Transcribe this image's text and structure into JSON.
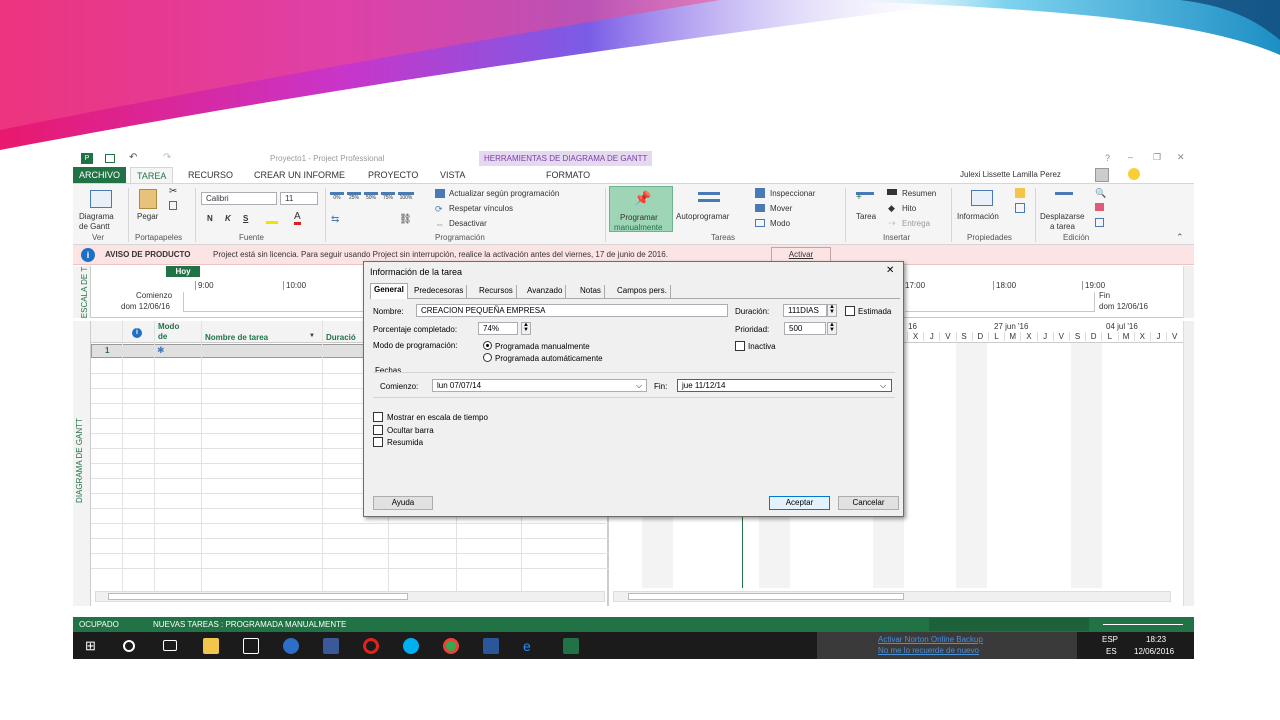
{
  "window": {
    "title": "Proyecto1 - Project Professional",
    "contextual_tab": "HERRAMIENTAS DE DIAGRAMA DE GANTT",
    "user": "Julexi Lissette Lamilla Perez"
  },
  "tabs": [
    "ARCHIVO",
    "TAREA",
    "RECURSO",
    "CREAR UN INFORME",
    "PROYECTO",
    "VISTA",
    "FORMATO"
  ],
  "ribbon": {
    "ver": {
      "btn": "Diagrama",
      "btn2": "de Gantt",
      "group": "Ver"
    },
    "portapapeles": {
      "btn": "Pegar",
      "group": "Portapapeles"
    },
    "fuente": {
      "font": "Calibri",
      "size": "11",
      "bold": "N",
      "italic": "K",
      "underline": "S",
      "group": "Fuente"
    },
    "programacion": {
      "pcts": [
        "0%",
        "25%",
        "50%",
        "75%",
        "100%"
      ],
      "update": "Actualizar según programación",
      "respect": "Respetar vínculos",
      "deactivate": "Desactivar",
      "group": "Programación"
    },
    "tareas": {
      "manual": "Programar",
      "manual2": "manualmente",
      "auto": "Autoprogramar",
      "inspect": "Inspeccionar",
      "move": "Mover",
      "mode": "Modo",
      "group": "Tareas"
    },
    "insertar": {
      "task": "Tarea",
      "summary": "Resumen",
      "milestone": "Hito",
      "deliverable": "Entrega",
      "group": "Insertar"
    },
    "propiedades": {
      "info": "Información",
      "group": "Propiedades"
    },
    "edicion": {
      "scroll": "Desplazarse",
      "scroll2": "a tarea",
      "group": "Edición"
    }
  },
  "notice": {
    "title": "AVISO DE PRODUCTO",
    "text": "Project está sin licencia. Para seguir usando Project sin interrupción, realice la activación antes del viernes, 17 de junio de 2016.",
    "button": "Activar"
  },
  "timeline": {
    "side": "ESCALA DE T",
    "today": "Hoy",
    "start": "Comienzo",
    "start_date": "dom 12/06/16",
    "end": "Fin",
    "end_date": "dom 12/06/16",
    "times_left": [
      "9:00",
      "10:00"
    ],
    "times_right": [
      "17:00",
      "18:00",
      "19:00"
    ]
  },
  "grid": {
    "side": "DIAGRAMA DE GANTT",
    "headers": {
      "mode": "Modo de",
      "name": "Nombre de tarea",
      "duration": "Duració"
    },
    "row_num": "1",
    "weeks": [
      "16",
      "27 jun '16",
      "04 jul '16"
    ],
    "days": [
      "X",
      "J",
      "V",
      "S",
      "D",
      "L",
      "M",
      "X",
      "J",
      "V",
      "S",
      "D",
      "L",
      "M",
      "X",
      "J",
      "V"
    ]
  },
  "dialog": {
    "title": "Información de la tarea",
    "tabs": [
      "General",
      "Predecesoras",
      "Recursos",
      "Avanzado",
      "Notas",
      "Campos pers."
    ],
    "name_label": "Nombre:",
    "name_value": "CREACION PEQUEÑA EMPRESA",
    "duration_label": "Duración:",
    "duration_value": "111DIAS",
    "estimated": "Estimada",
    "pct_label": "Porcentaje completado:",
    "pct_value": "74%",
    "priority_label": "Prioridad:",
    "priority_value": "500",
    "mode_label": "Modo de programación:",
    "mode_manual": "Programada manualmente",
    "mode_auto": "Programada automáticamente",
    "inactive": "Inactiva",
    "dates_label": "Fechas",
    "start_label": "Comienzo:",
    "start_value": "lun 07/07/14",
    "end_label": "Fin:",
    "end_value": "jue 11/12/14",
    "show_timeline": "Mostrar en escala de tiempo",
    "hide_bar": "Ocultar barra",
    "summary": "Resumida",
    "help": "Ayuda",
    "ok": "Aceptar",
    "cancel": "Cancelar"
  },
  "status": {
    "state": "OCUPADO",
    "new_tasks": "NUEVAS TAREAS : PROGRAMADA MANUALMENTE"
  },
  "taskbar": {
    "notif1": "Activar Norton Online Backup",
    "notif2": "No me lo recuerde de nuevo",
    "lang1": "ESP",
    "lang2": "ES",
    "time": "18:23",
    "date": "12/06/2016"
  }
}
